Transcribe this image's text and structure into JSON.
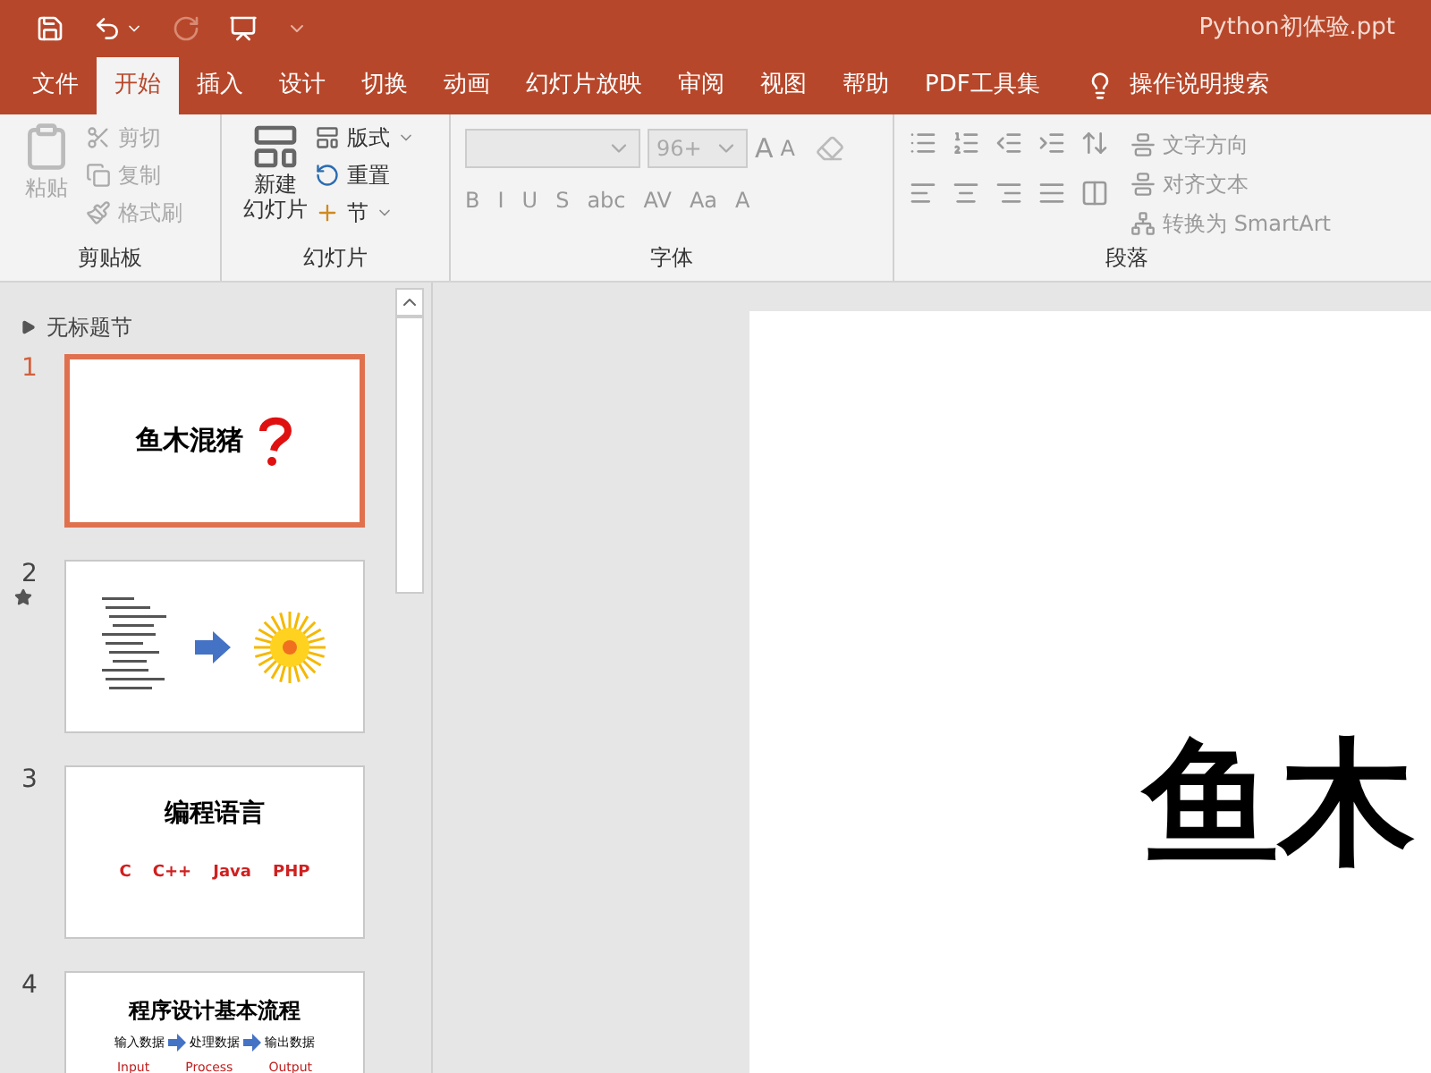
{
  "window": {
    "title": "Python初体验.ppt"
  },
  "tabs": [
    {
      "label": "文件",
      "selected": false
    },
    {
      "label": "开始",
      "selected": true
    },
    {
      "label": "插入",
      "selected": false
    },
    {
      "label": "设计",
      "selected": false
    },
    {
      "label": "切换",
      "selected": false
    },
    {
      "label": "动画",
      "selected": false
    },
    {
      "label": "幻灯片放映",
      "selected": false
    },
    {
      "label": "审阅",
      "selected": false
    },
    {
      "label": "视图",
      "selected": false
    },
    {
      "label": "帮助",
      "selected": false
    },
    {
      "label": "PDF工具集",
      "selected": false
    }
  ],
  "tell_me": {
    "label": "操作说明搜索"
  },
  "ribbon": {
    "clipboard": {
      "label": "剪贴板",
      "paste": "粘贴",
      "cut": "剪切",
      "copy": "复制",
      "format_painter": "格式刷",
      "disabled": true
    },
    "slides": {
      "label": "幻灯片",
      "new_slide_line1": "新建",
      "new_slide_line2": "幻灯片",
      "layout": "版式",
      "reset": "重置",
      "section": "节"
    },
    "font": {
      "label": "字体",
      "size": "96+",
      "size_buttons": [
        "A",
        "A"
      ],
      "buttons": [
        "B",
        "I",
        "U",
        "S",
        "abc",
        "AV",
        "Aa",
        "A"
      ]
    },
    "paragraph": {
      "label": "段落",
      "text_direction": "文字方向",
      "align_text": "对齐文本",
      "smartart": "转换为 SmartArt"
    }
  },
  "outline": {
    "section": "无标题节",
    "slides": [
      {
        "number": "1",
        "selected": true,
        "starred": false,
        "kind": "title",
        "title": "鱼木混猪"
      },
      {
        "number": "2",
        "selected": false,
        "starred": true,
        "kind": "code"
      },
      {
        "number": "3",
        "selected": false,
        "starred": false,
        "kind": "languages",
        "title": "编程语言",
        "items": [
          "C",
          "C++",
          "Java",
          "PHP"
        ]
      },
      {
        "number": "4",
        "selected": false,
        "starred": false,
        "kind": "flow",
        "title": "程序设计基本流程",
        "steps": [
          "输入数据",
          "处理数据",
          "输出数据"
        ],
        "captions": [
          "Input",
          "Process",
          "Output"
        ]
      }
    ]
  },
  "slide": {
    "title": "鱼木"
  }
}
